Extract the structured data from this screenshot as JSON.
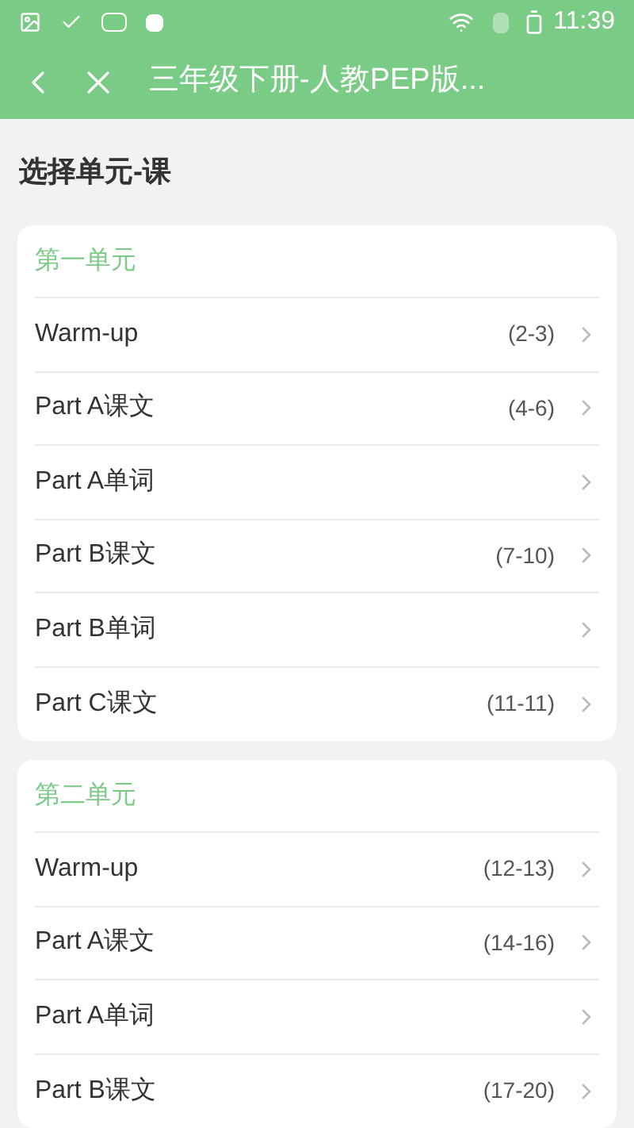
{
  "status_bar": {
    "time": "11:39"
  },
  "app_bar": {
    "title": "三年级下册-人教PEP版..."
  },
  "heading": "选择单元-课",
  "units": [
    {
      "title": "第一单元",
      "lessons": [
        {
          "name": "Warm-up",
          "pages": "(2-3)"
        },
        {
          "name": "Part A课文",
          "pages": "(4-6)"
        },
        {
          "name": "Part A单词"
        },
        {
          "name": "Part B课文",
          "pages": "(7-10)"
        },
        {
          "name": "Part B单词"
        },
        {
          "name": "Part C课文",
          "pages": "(11-11)"
        }
      ]
    },
    {
      "title": "第二单元",
      "lessons": [
        {
          "name": "Warm-up",
          "pages": "(12-13)"
        },
        {
          "name": "Part A课文",
          "pages": "(14-16)"
        },
        {
          "name": "Part A单词"
        },
        {
          "name": "Part B课文",
          "pages": "(17-20)"
        }
      ]
    }
  ]
}
